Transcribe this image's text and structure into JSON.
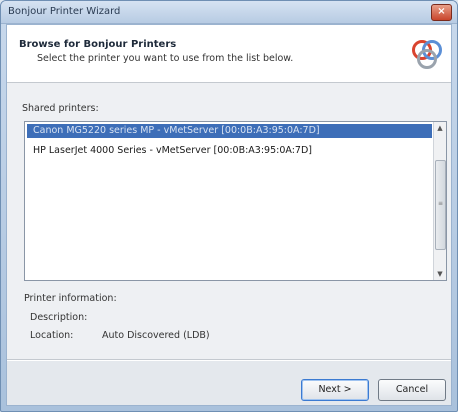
{
  "window": {
    "title": "Bonjour Printer Wizard",
    "close_glyph": "×"
  },
  "header": {
    "title": "Browse for Bonjour Printers",
    "subtitle": "Select the printer you want to use from the list below.",
    "logo_icon": "bonjour-logo"
  },
  "shared_printers": {
    "label": "Shared printers:",
    "items": [
      {
        "label": "Canon MG5220 series MP - vMetServer [00:0B:A3:95:0A:7D]",
        "selected": true
      },
      {
        "label": "HP LaserJet 4000 Series - vMetServer [00:0B:A3:95:0A:7D]",
        "selected": false
      }
    ]
  },
  "printer_info": {
    "title": "Printer information:",
    "description_label": "Description:",
    "description_value": "",
    "location_label": "Location:",
    "location_value": "Auto Discovered (LDB)"
  },
  "buttons": {
    "next": "Next >",
    "cancel": "Cancel"
  },
  "colors": {
    "selection": "#3d6eb8",
    "accent": "#3b7ad1"
  }
}
